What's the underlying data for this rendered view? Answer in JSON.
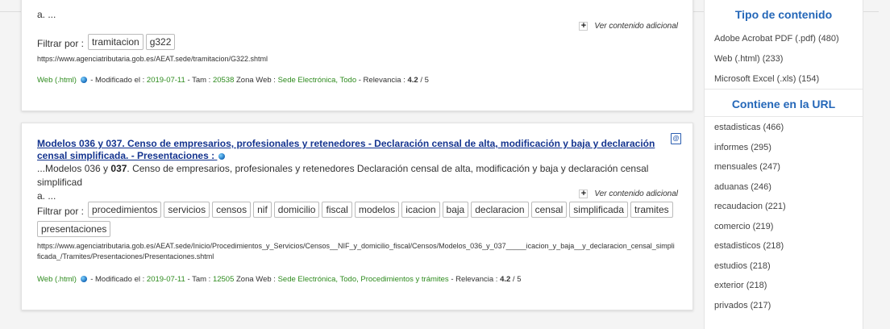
{
  "results": [
    {
      "snippet_end": "a. ...",
      "more_label": "Ver contenido adicional",
      "filter_label": "Filtrar por :",
      "tags": [
        "tramitacion",
        "g322"
      ],
      "url": "https://www.agenciatributaria.gob.es/AEAT.sede/tramitacion/G322.shtml",
      "meta": {
        "type": "Web (.html)",
        "modified_label": "- Modificado el :",
        "modified": "2019-07-11",
        "size_label": "- Tam :",
        "size": "20538",
        "zone_label": "Zona Web :",
        "zone": "Sede Electrónica, Todo",
        "relevance_label": "- Relevancia :",
        "relevance": "4.2",
        "relevance_max": "/ 5"
      }
    },
    {
      "title": "Modelos 036 y 037. Censo de empresarios, profesionales y retenedores - Declaración censal de alta, modificación y baja y declaración censal simplificada. - Presentaciones :",
      "snippet_prefix": "...Modelos 036 y ",
      "snippet_bold": "037",
      "snippet_rest": ". Censo de empresarios, profesionales y retenedores Declaración censal de alta, modificación y baja y declaración censal simplificad",
      "snippet_end": "a. ...",
      "more_label": "Ver contenido adicional",
      "filter_label": "Filtrar por :",
      "tags": [
        "procedimientos",
        "servicios",
        "censos",
        "nif",
        "domicilio",
        "fiscal",
        "modelos",
        "icacion",
        "baja",
        "declaracion",
        "censal",
        "simplificada",
        "tramites",
        "presentaciones"
      ],
      "url": "https://www.agenciatributaria.gob.es/AEAT.sede/Inicio/Procedimientos_y_Servicios/Censos__NIF_y_domicilio_fiscal/Censos/Modelos_036_y_037_____icacion_y_baja__y_declaracion_censal_simplificada_/Tramites/Presentaciones/Presentaciones.shtml",
      "meta": {
        "type": "Web (.html)",
        "modified_label": "- Modificado el :",
        "modified": "2019-07-11",
        "size_label": "- Tam :",
        "size": "12505",
        "zone_label": "Zona Web :",
        "zone": "Sede Electrónica, Todo, Procedimientos y trámites",
        "relevance_label": "- Relevancia :",
        "relevance": "4.2",
        "relevance_max": "/ 5"
      }
    }
  ],
  "sidebar": {
    "content_type_heading": "Tipo de contenido",
    "content_types": [
      "Adobe Acrobat PDF (.pdf) (480)",
      "Web (.html) (233)",
      "Microsoft Excel (.xls) (154)"
    ],
    "url_heading": "Contiene en la URL",
    "url_terms": [
      "estadisticas (466)",
      "informes (295)",
      "mensuales (247)",
      "aduanas (246)",
      "recaudacion (221)",
      "comercio (219)",
      "estadisticos (218)",
      "estudios (218)",
      "exterior (218)",
      "privados (217)"
    ]
  },
  "colors": {
    "link": "#14348f",
    "green": "#2e8b1e",
    "heading": "#2467b8"
  }
}
